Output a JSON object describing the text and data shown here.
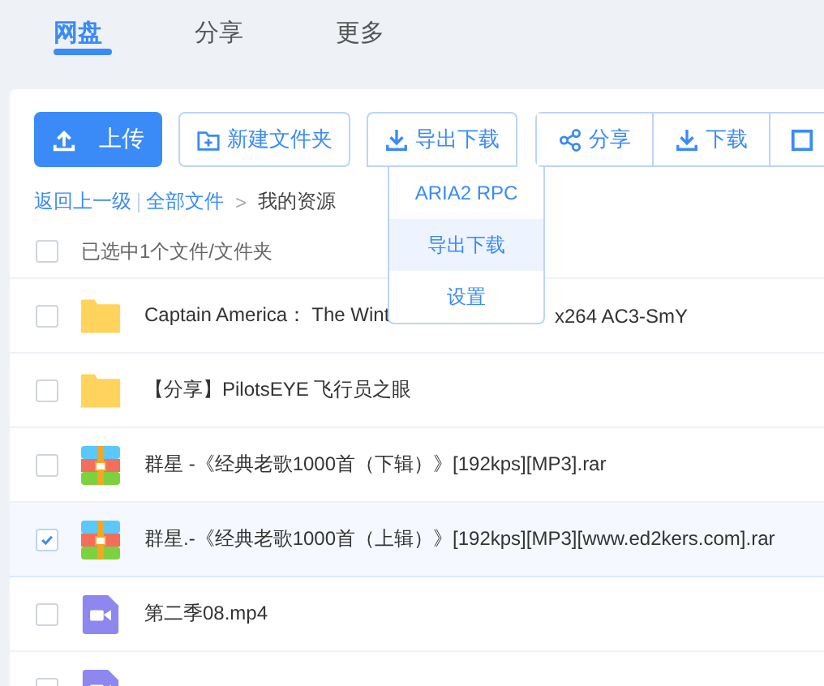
{
  "tabs": [
    {
      "label": "网盘",
      "selected": true
    },
    {
      "label": "分享",
      "selected": false
    },
    {
      "label": "更多",
      "selected": false
    }
  ],
  "toolbar": {
    "upload": "上传",
    "new_folder": "新建文件夹",
    "export": "导出下载",
    "share": "分享",
    "download": "下载"
  },
  "export_menu": [
    {
      "label": "ARIA2 RPC",
      "selected": false
    },
    {
      "label": "导出下载",
      "selected": true
    },
    {
      "label": "设置",
      "selected": false
    }
  ],
  "breadcrumb": {
    "back": "返回上一级",
    "root": "全部文件",
    "separator": ">",
    "current": "我的资源"
  },
  "selection": {
    "checked": false,
    "text": "已选中1个文件/文件夹"
  },
  "files": [
    {
      "kind": "folder",
      "name": "Captain America： The Wint",
      "name_tail": "x264 AC3-SmY",
      "checked": false
    },
    {
      "kind": "folder",
      "name": "【分享】PilotsEYE 飞行员之眼",
      "checked": false
    },
    {
      "kind": "archive",
      "name": "群星 -《经典老歌1000首（下辑）》[192kps][MP3].rar",
      "checked": false
    },
    {
      "kind": "archive",
      "name": "群星.-《经典老歌1000首（上辑）》[192kps][MP3][www.ed2kers.com].rar",
      "checked": true
    },
    {
      "kind": "video",
      "name": "第二季08.mp4",
      "checked": false
    },
    {
      "kind": "video",
      "checked": false
    }
  ]
}
